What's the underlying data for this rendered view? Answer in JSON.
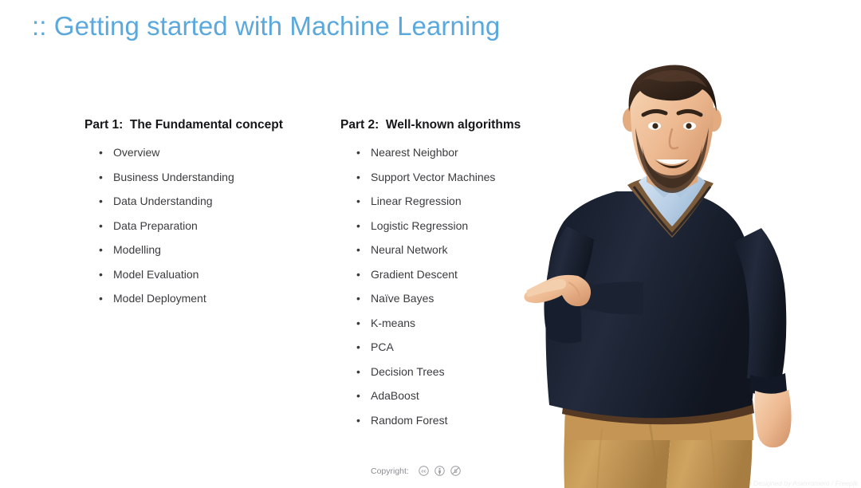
{
  "slide": {
    "title": ":: Getting started with Machine Learning",
    "background_color": "#ffffff",
    "title_color": "#5BA9DC"
  },
  "columns": [
    {
      "header": "Part 1:  The Fundamental concept",
      "items": [
        "Overview",
        "Business Understanding",
        "Data Understanding",
        "Data Preparation",
        "Modelling",
        "Model Evaluation",
        "Model Deployment"
      ]
    },
    {
      "header": "Part 2:  Well-known algorithms",
      "items": [
        "Nearest Neighbor",
        "Support Vector Machines",
        "Linear Regression",
        "Logistic Regression",
        "Neural Network",
        "Gradient Descent",
        "Naïve Bayes",
        "K-means",
        "PCA",
        "Decision Trees",
        "AdaBoost",
        "Random Forest"
      ]
    }
  ],
  "copyright": {
    "label": "Copyright:",
    "badges": [
      "creative-commons-icon",
      "cc-by-icon",
      "cc-nc-icon"
    ]
  },
  "attribution": "Image Designed by Asierromero / Freepik",
  "photo": {
    "description": "Smiling bearded man in navy v-neck sweater over light blue shirt, tan trousers with brown belt, pointing left",
    "colors": {
      "sweater": "#1d2433",
      "shirt": "#bed3e8",
      "skin": "#eebb96",
      "hair": "#3a2a1e",
      "trousers": "#c79a56",
      "belt": "#4d3522",
      "patch": "#7b5a3a"
    }
  }
}
